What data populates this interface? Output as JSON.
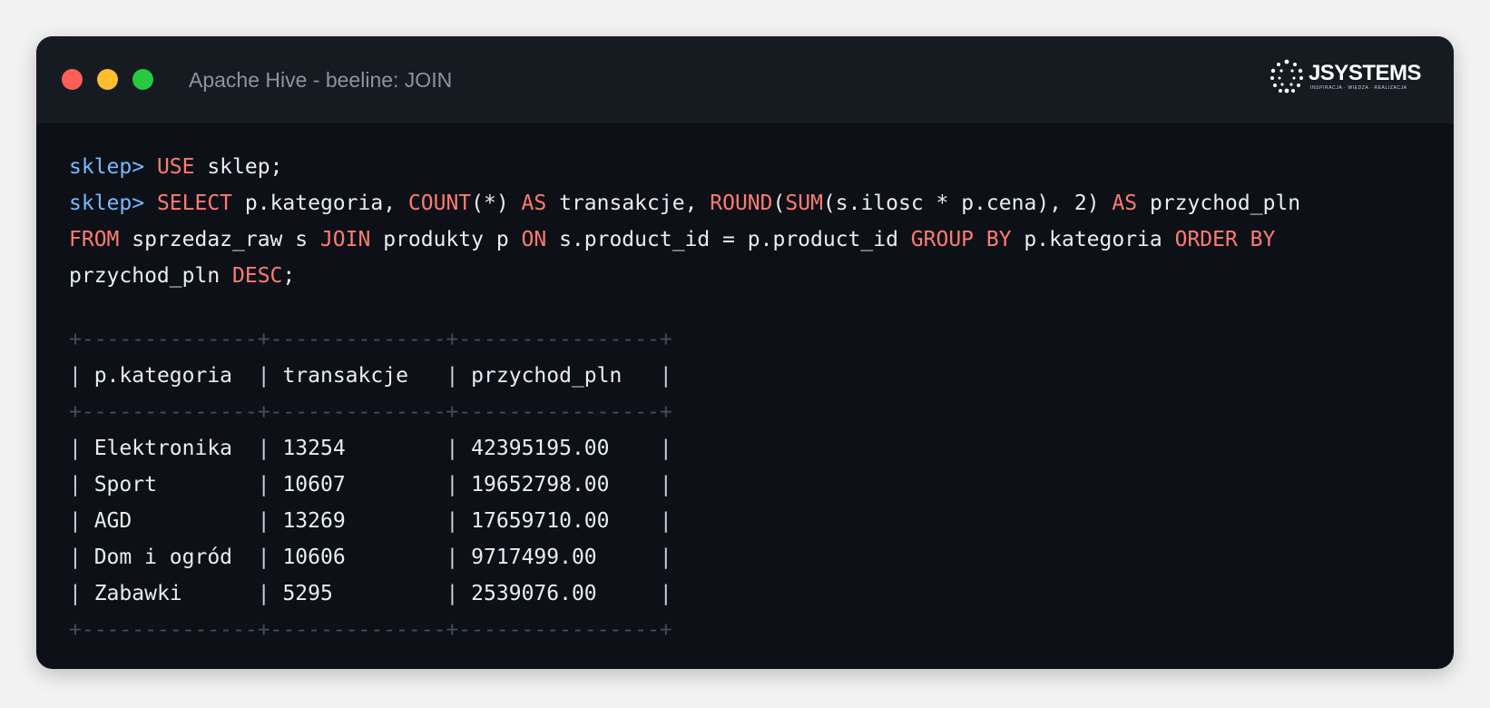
{
  "window": {
    "title": "Apache Hive - beeline: JOIN",
    "logo_name": "JSYSTEMS",
    "logo_tagline": "INSPIRACJA · WIEDZA · REALIZACJA"
  },
  "terminal": {
    "prompt": "sklep>",
    "command_lines": [
      [
        {
          "t": "sklep> ",
          "c": "prompt"
        },
        {
          "t": "USE",
          "c": "kw"
        },
        {
          "t": " sklep;",
          "c": ""
        }
      ],
      [
        {
          "t": "sklep> ",
          "c": "prompt"
        },
        {
          "t": "SELECT",
          "c": "kw"
        },
        {
          "t": " p.kategoria, ",
          "c": ""
        },
        {
          "t": "COUNT",
          "c": "kw"
        },
        {
          "t": "(*) ",
          "c": ""
        },
        {
          "t": "AS",
          "c": "kw"
        },
        {
          "t": " transakcje, ",
          "c": ""
        },
        {
          "t": "ROUND",
          "c": "kw"
        },
        {
          "t": "(",
          "c": ""
        },
        {
          "t": "SUM",
          "c": "kw"
        },
        {
          "t": "(s.ilosc * p.cena), 2) ",
          "c": ""
        },
        {
          "t": "AS",
          "c": "kw"
        },
        {
          "t": " przychod_pln",
          "c": ""
        }
      ],
      [
        {
          "t": "FROM",
          "c": "kw"
        },
        {
          "t": " sprzedaz_raw s ",
          "c": ""
        },
        {
          "t": "JOIN",
          "c": "kw"
        },
        {
          "t": " produkty p ",
          "c": ""
        },
        {
          "t": "ON",
          "c": "kw"
        },
        {
          "t": " s.product_id = p.product_id ",
          "c": ""
        },
        {
          "t": "GROUP BY",
          "c": "kw"
        },
        {
          "t": " p.kategoria ",
          "c": ""
        },
        {
          "t": "ORDER BY",
          "c": "kw"
        }
      ],
      [
        {
          "t": "przychod_pln ",
          "c": ""
        },
        {
          "t": "DESC",
          "c": "kw"
        },
        {
          "t": ";",
          "c": ""
        }
      ]
    ]
  },
  "result_table": {
    "border": "+--------------+--------------+----------------+",
    "headers": [
      "p.kategoria",
      "transakcje",
      "przychod_pln"
    ],
    "rows": [
      [
        "Elektronika",
        "13254",
        "42395195.00"
      ],
      [
        "Sport",
        "10607",
        "19652798.00"
      ],
      [
        "AGD",
        "13269",
        "17659710.00"
      ],
      [
        "Dom i ogród",
        "10606",
        "9717499.00"
      ],
      [
        "Zabawki",
        "5295",
        "2539076.00"
      ]
    ]
  },
  "colors": {
    "background": "#f2f2f2",
    "window_bg": "#0d1117",
    "titlebar_bg": "#161b22",
    "prompt": "#79b8ff",
    "keyword": "#ff7b72",
    "text": "#e6edf3",
    "table_border": "#444c56",
    "dot_close": "#ff5f56",
    "dot_minimize": "#ffbd2e",
    "dot_maximize": "#27c93f"
  }
}
